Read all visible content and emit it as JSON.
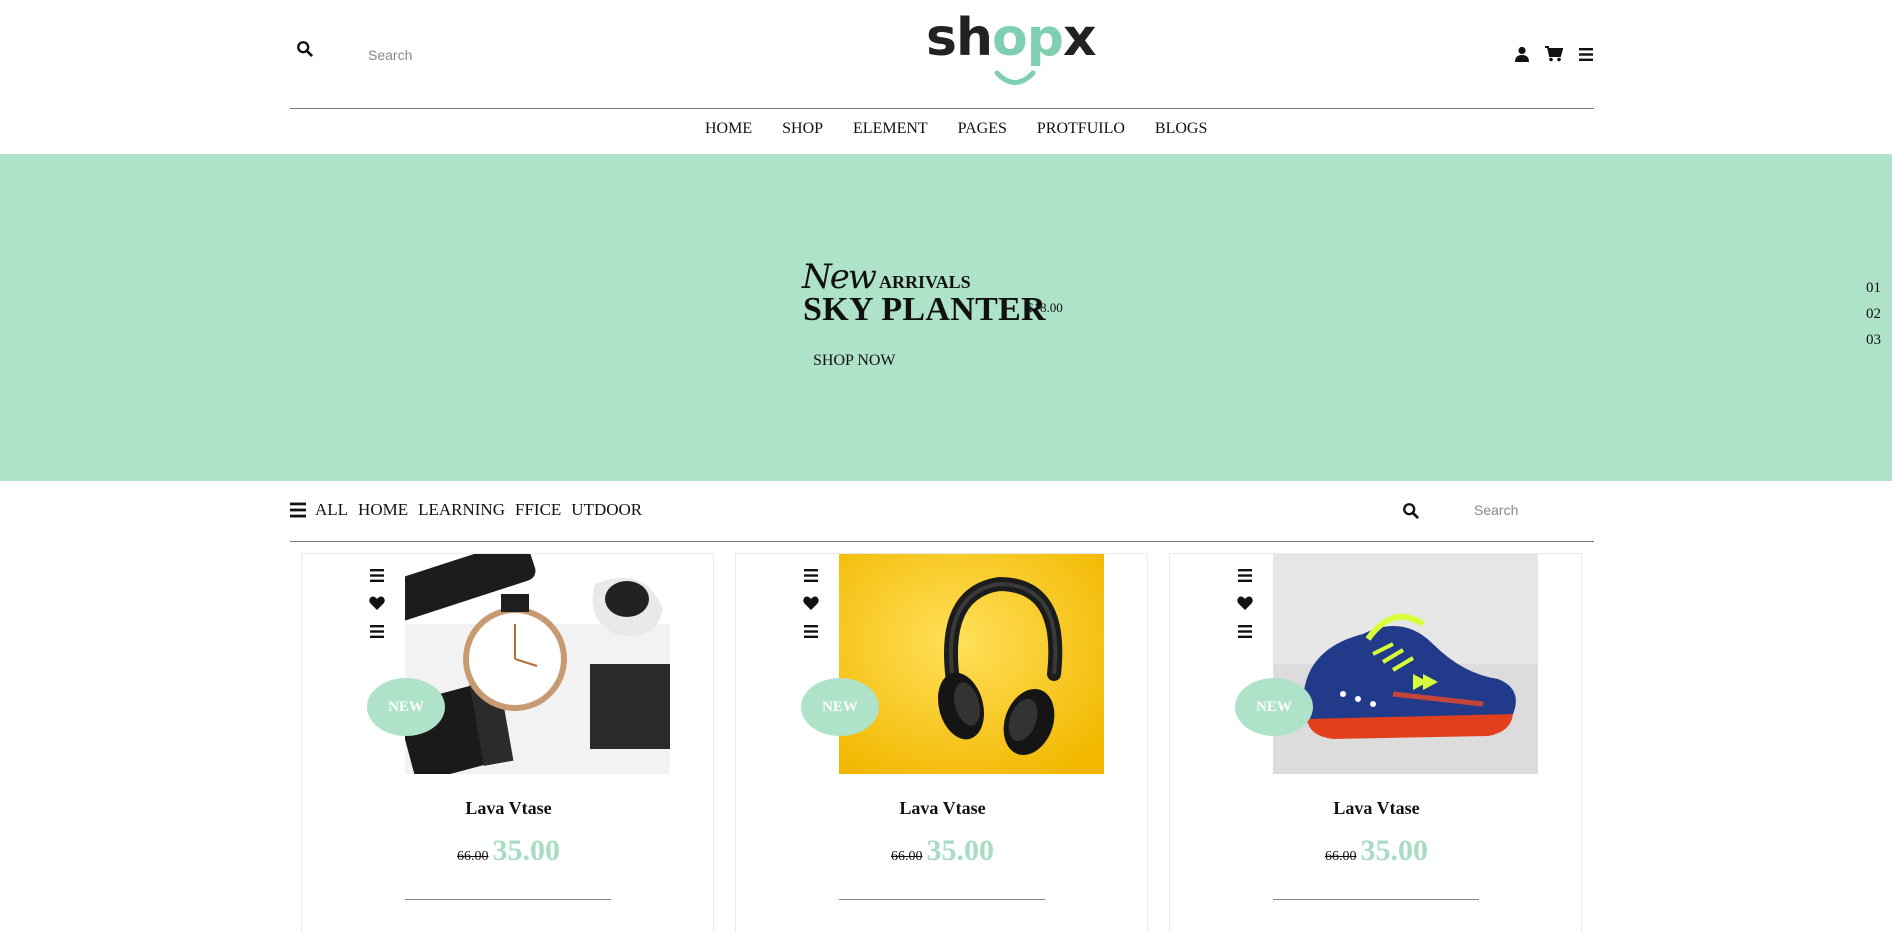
{
  "header": {
    "search_placeholder": "Search",
    "logo": {
      "prefix": "sh",
      "accent": "o",
      "p": "p",
      "suffix": "x"
    },
    "icons": [
      "user-icon",
      "cart-icon",
      "menu-icon"
    ]
  },
  "nav": {
    "items": [
      "HOME",
      "SHOP",
      "ELEMENT",
      "PAGES",
      "PROTFUILO",
      "BLOGS"
    ]
  },
  "hero": {
    "new_label": "New",
    "arrivals_label": "ARRIVALS",
    "title": "SKY PLANTER",
    "price": "$18.00",
    "cta": "SHOP NOW",
    "slides": [
      "01",
      "02",
      "03"
    ],
    "background_color": "#aee2c9"
  },
  "filter": {
    "tabs": [
      "ALL",
      "HOME",
      "LEARNING",
      "FFICE",
      "UTDOOR"
    ],
    "search_placeholder": "Search"
  },
  "products": [
    {
      "name": "Lava Vtase",
      "old_price": "66.00",
      "price": "35.00",
      "badge": "NEW",
      "image": "watch"
    },
    {
      "name": "Lava Vtase",
      "old_price": "66.00",
      "price": "35.00",
      "badge": "NEW",
      "image": "headphones"
    },
    {
      "name": "Lava Vtase",
      "old_price": "66.00",
      "price": "35.00",
      "badge": "NEW",
      "image": "sneaker"
    }
  ],
  "colors": {
    "accent": "#aee2c9",
    "price": "#a8dcc3"
  }
}
